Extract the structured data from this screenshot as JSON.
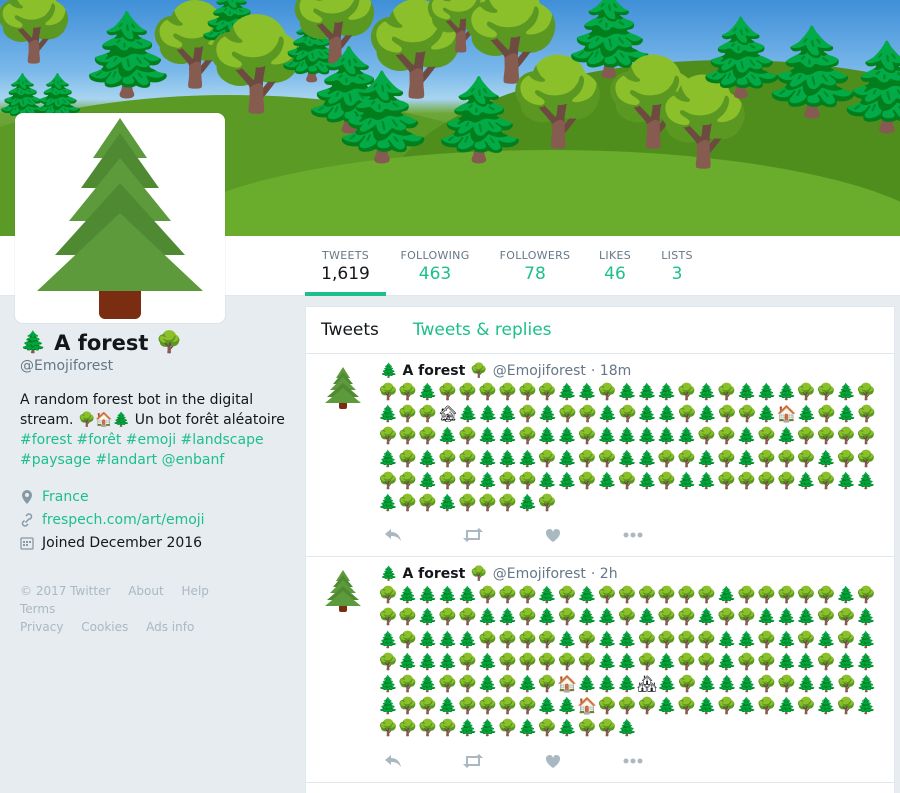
{
  "profile": {
    "name": "A forest",
    "name_left_emoji": "🌲",
    "name_right_emoji": "🌳",
    "handle": "@Emojiforest",
    "bio_prefix": "A random forest bot in the digital stream. 🌳🏠🌲 Un bot forêt aléatoire ",
    "bio_tags": [
      "#forest",
      "#forêt",
      "#emoji",
      "#landscape",
      "#paysage",
      "#landart",
      "@enbanf"
    ],
    "location": "France",
    "website": "frespech.com/art/emoji",
    "joined": "Joined December 2016"
  },
  "stats": [
    {
      "label": "TWEETS",
      "value": "1,619"
    },
    {
      "label": "FOLLOWING",
      "value": "463"
    },
    {
      "label": "FOLLOWERS",
      "value": "78"
    },
    {
      "label": "LIKES",
      "value": "46"
    },
    {
      "label": "LISTS",
      "value": "3"
    }
  ],
  "footer_links": [
    "© 2017 Twitter",
    "About",
    "Help",
    "Terms",
    "Privacy",
    "Cookies",
    "Ads info"
  ],
  "tabs": [
    "Tweets",
    "Tweets & replies"
  ],
  "tweets": [
    {
      "name": "A forest",
      "name_left_emoji": "🌲",
      "name_right_emoji": "🌳",
      "handle": "@Emojiforest",
      "time": "· 18m",
      "body": "🌳🌳🌲🌳🌳🌳🌳🌳🌳🌲🌲🌳🌲🌲🌲🌳🌲🌳🌲🌲🌲🌳🌳🌲🌳🌲🌳🌳🏚🌲🌲🌲🌳🌲🌳🌳🌲🌳🌲🌲🌳🌲🌳🌳🌲🏠🌲🌳🌲🌳🌳🌳🌳🌲🌳🌲🌲🌳🌲🌲🌳🌲🌲🌲🌲🌲🌳🌳🌲🌳🌲🌳🌳🌳🌳🌲🌳🌲🌳🌳🌲🌲🌲🌳🌲🌳🌳🌲🌲🌳🌳🌲🌳🌲🌳🌳🌳🌲🌳🌳🌳🌳🌲🌳🌳🌲🌳🌳🌲🌲🌳🌲🌳🌲🌳🌲🌲🌳🌳🌳🌳🌲🌳🌲🌲🌲🌳🌳🌲🌳🌳🌳🌲🌳",
      "reply_icon": "reply-icon",
      "retweet_icon": "retweet-icon",
      "like_icon": "heart-icon",
      "more_icon": "more-icon"
    },
    {
      "name": "A forest",
      "name_left_emoji": "🌲",
      "name_right_emoji": "🌳",
      "handle": "@Emojiforest",
      "time": "· 2h",
      "body": "🌳🌲🌲🌲🌲🌳🌳🌳🌲🌳🌲🌳🌳🌳🌳🌳🌳🌲🌳🌳🌳🌳🌳🌲🌳🌳🌳🌲🌳🌳🌲🌲🌳🌲🌳🌲🌲🌳🌲🌳🌳🌲🌳🌳🌲🌲🌲🌳🌳🌲🌲🌳🌲🌲🌲🌳🌳🌳🌳🌲🌳🌲🌲🌳🌳🌳🌳🌲🌲🌳🌲🌳🌲🌳🌲🌳🌲🌲🌲🌳🌲🌳🌳🌳🌳🌳🌲🌲🌳🌲🌳🌳🌲🌳🌳🌲🌲🌳🌲🌲🌲🌳🌲🌳🌳🌲🌳🌲🌳🏠🌲🌲🌲🏘🌲🌳🌲🌲🌲🌳🌳🌲🌲🌳🌲🌲🌳🌳🌲🌳🌳🌳🌳🌲🌲🏠🌳🌳🌳🌲🌳🌲🌳🌲🌳🌲🌳🌲🌳🌲🌳🌳🌳🌳🌲🌲🌳🌲🌳🌲🌳🌳🌲",
      "reply_icon": "reply-icon",
      "retweet_icon": "retweet-icon",
      "like_icon": "heart-icon",
      "more_icon": "more-icon"
    }
  ],
  "colors": {
    "accent": "#1dbf8b",
    "text": "#14171a",
    "muted": "#657786",
    "background": "#e6ecf0"
  }
}
